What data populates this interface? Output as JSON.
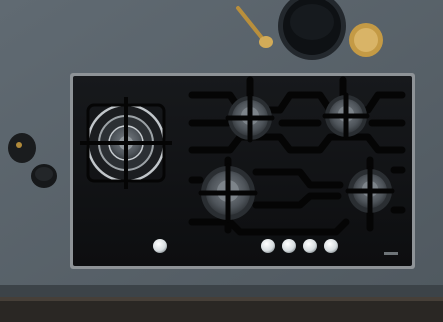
{
  "scene": {
    "subject": "gas-hob",
    "colors": {
      "countertop": "#59636b",
      "countertop_edge": "#3c4348",
      "floor": "#2a2724",
      "glass": "#111214",
      "glass_frame": "#8e9397",
      "grate": "#050505",
      "burner": "#545a60",
      "steel": "#c7ccd0",
      "knob": "#e9eef0",
      "gold": "#c9a14a",
      "bowl": "#14181d"
    },
    "knob_count": 5,
    "burner_count": 5,
    "icons": [
      "wok-burner-icon",
      "burner-icon",
      "knob-icon",
      "spoon-icon",
      "bowl-icon",
      "jar-icon"
    ]
  }
}
